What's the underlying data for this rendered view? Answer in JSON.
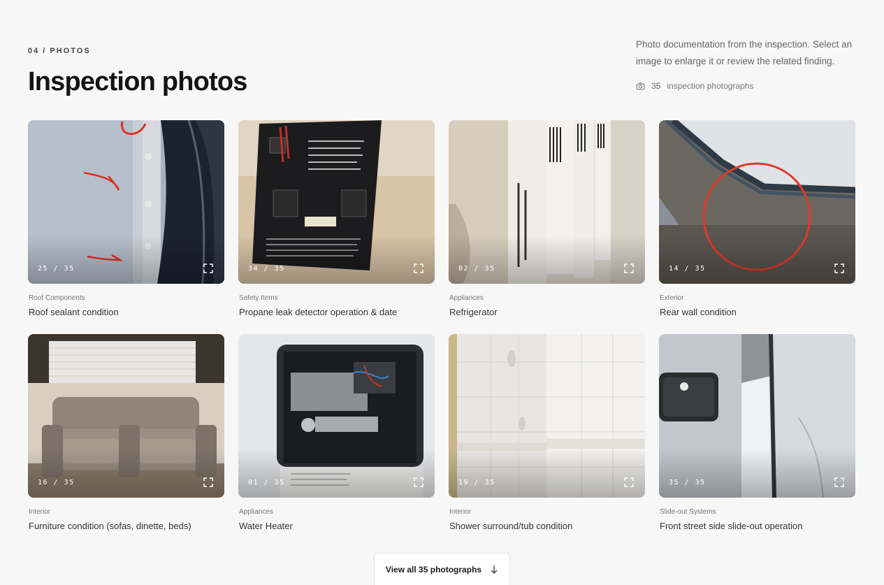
{
  "section": {
    "eyebrow": "04 / PHOTOS",
    "title": "Inspection photos",
    "description": "Photo documentation from the inspection. Select an image to enlarge it or review the related finding.",
    "photo_count": "35",
    "photo_count_label": "inspection photographs"
  },
  "photos": [
    {
      "badge": "25 / 35",
      "category": "Roof Components",
      "label": "Roof sealant condition"
    },
    {
      "badge": "34 / 35",
      "category": "Safety Items",
      "label": "Propane leak detector operation & date"
    },
    {
      "badge": "02 / 35",
      "category": "Appliances",
      "label": "Refrigerator"
    },
    {
      "badge": "14 / 35",
      "category": "Exterior",
      "label": "Rear wall condition"
    },
    {
      "badge": "16 / 35",
      "category": "Interior",
      "label": "Furniture condition (sofas, dinette, beds)"
    },
    {
      "badge": "01 / 35",
      "category": "Appliances",
      "label": "Water Heater"
    },
    {
      "badge": "19 / 35",
      "category": "Interior",
      "label": "Shower surround/tub condition"
    },
    {
      "badge": "35 / 35",
      "category": "Slide-out Systems",
      "label": "Front street side slide-out operation"
    }
  ],
  "view_all": {
    "label": "View all 35 photographs"
  },
  "icons": {
    "camera": "camera-icon",
    "expand": "expand-icon",
    "arrow": "arrow-down-icon"
  }
}
